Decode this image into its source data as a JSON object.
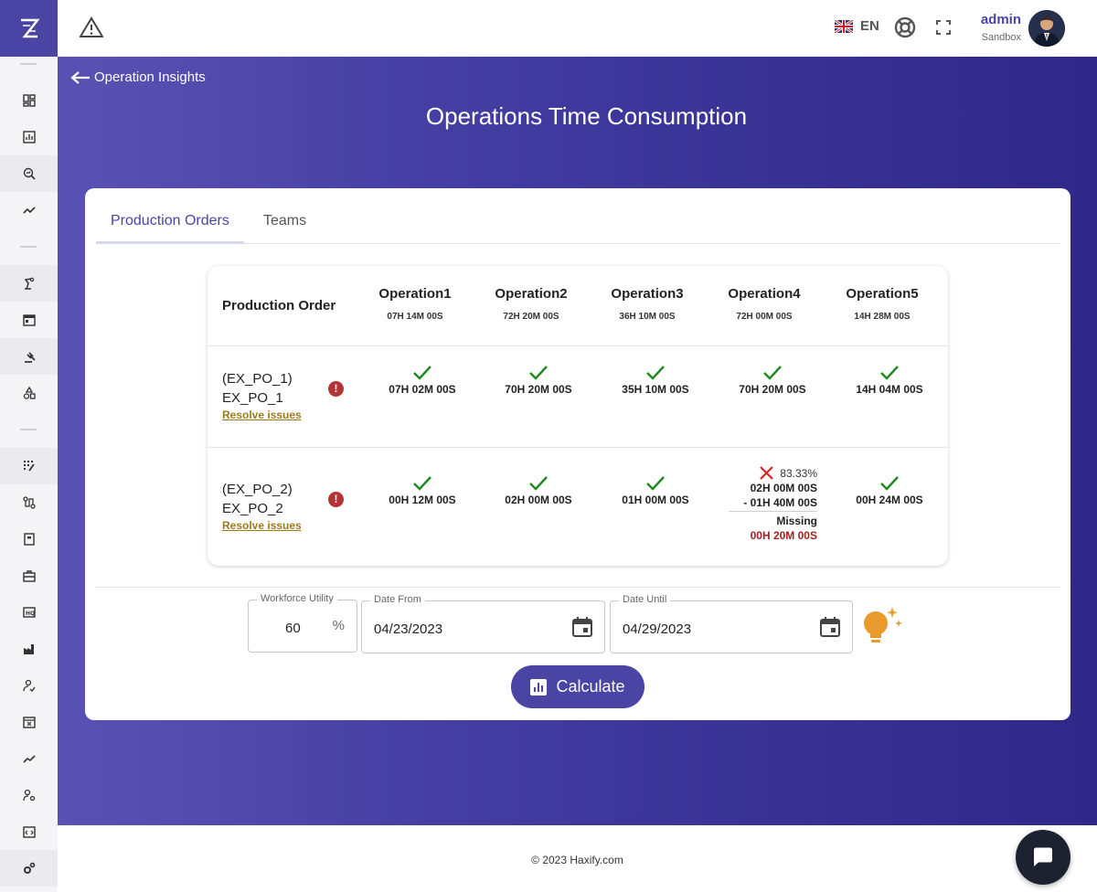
{
  "header": {
    "language": "EN",
    "user_name": "admin",
    "user_org": "Sandbox"
  },
  "nav": {
    "back_label": "Operation Insights"
  },
  "page": {
    "title": "Operations Time Consumption"
  },
  "tabs": [
    {
      "label": "Production Orders",
      "active": true
    },
    {
      "label": "Teams",
      "active": false
    }
  ],
  "table": {
    "header_po": "Production Order",
    "operations": [
      {
        "name": "Operation1",
        "total": "07H 14M 00S"
      },
      {
        "name": "Operation2",
        "total": "72H 20M 00S"
      },
      {
        "name": "Operation3",
        "total": "36H 10M 00S"
      },
      {
        "name": "Operation4",
        "total": "72H 00M 00S"
      },
      {
        "name": "Operation5",
        "total": "14H 28M 00S"
      }
    ],
    "rows": [
      {
        "id_line1": "(EX_PO_1)",
        "id_line2": "EX_PO_1",
        "resolve_label": "Resolve issues",
        "cells": [
          "07H 02M 00S",
          "70H 20M 00S",
          "35H 10M 00S",
          "70H 20M 00S",
          "14H 04M 00S"
        ]
      },
      {
        "id_line1": "(EX_PO_2)",
        "id_line2": "EX_PO_2",
        "resolve_label": "Resolve issues",
        "cells": [
          "00H 12M 00S",
          "02H 00M 00S",
          "01H 00M 00S",
          "",
          "00H 24M 00S"
        ],
        "op4_detail": {
          "percent": "83.33%",
          "planned": "02H 00M 00S",
          "actual": "- 01H 40M 00S",
          "missing_label": "Missing",
          "missing_time": "00H 20M 00S"
        }
      }
    ]
  },
  "form": {
    "workforce_label": "Workforce Utility",
    "workforce_value": "60",
    "workforce_suffix": "%",
    "date_from_label": "Date From",
    "date_from_value": "04/23/2023",
    "date_until_label": "Date Until",
    "date_until_value": "04/29/2023",
    "calculate_label": "Calculate"
  },
  "footer": {
    "copyright": "© 2023 Haxify.com"
  },
  "colors": {
    "brand": "#4a44a4",
    "ok_check": "#1e8a1e",
    "error_x": "#d42424",
    "warning_link": "#9d7b1d",
    "bulb": "#e89a2c"
  },
  "icons": {
    "sidebar": [
      "dashboard-icon",
      "bar-chart-icon",
      "search-analytics-icon",
      "trend-icon",
      "robot-arm-icon",
      "calendar-icon",
      "gavel-icon",
      "shapes-icon",
      "grid-edit-icon",
      "route-icon",
      "report-icon",
      "toolbox-icon",
      "hq-icon",
      "factory-icon",
      "person-check-icon",
      "calendar-x-icon",
      "line-chart-icon",
      "person-settings-icon",
      "code-box-icon",
      "settings-icon"
    ]
  }
}
